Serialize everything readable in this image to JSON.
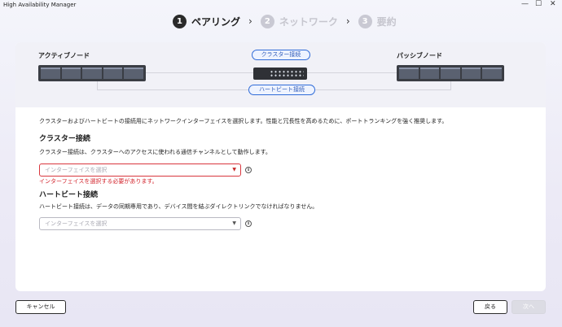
{
  "window": {
    "title": "High Availability Manager",
    "minimize_glyph": "—",
    "maximize_glyph": "☐",
    "close_glyph": "✕"
  },
  "stepper": {
    "steps": [
      {
        "number": "1",
        "label": "ペアリング",
        "active": true
      },
      {
        "number": "2",
        "label": "ネットワーク",
        "active": false
      },
      {
        "number": "3",
        "label": "要約",
        "active": false
      }
    ],
    "separator_glyph": "›"
  },
  "diagram": {
    "active_node_label": "アクティブノード",
    "passive_node_label": "パッシブノード",
    "cluster_link_label": "クラスター接続",
    "heartbeat_link_label": "ハートビート接続"
  },
  "description": "クラスターおよびハートビートの接続用にネットワークインターフェイスを選択します。性能と冗長性を高めるために、ポートトランキングを強く推奨します。",
  "cluster": {
    "title": "クラスター接続",
    "description": "クラスター接続は、クラスターへのアクセスに使われる通信チャンネルとして動作します。",
    "select_placeholder": "インターフェイスを選択",
    "error": "インターフェイスを選択する必要があります。",
    "caret_glyph": "▼",
    "info_glyph": "i"
  },
  "heartbeat": {
    "title": "ハートビート接続",
    "description": "ハートビート接続は、データの同期専用であり、デバイス間を結ぶダイレクトリンクでなければなりません。",
    "select_placeholder": "インターフェイスを選択",
    "caret_glyph": "▼",
    "info_glyph": "i"
  },
  "footer": {
    "cancel_label": "キャンセル",
    "back_label": "戻る",
    "next_label": "次へ"
  },
  "colors": {
    "accent": "#2f6bd8",
    "error": "#d3262e",
    "active_step": "#2a2a2a",
    "inactive_step": "#c9c9d3"
  },
  "icons": {
    "info": "info-icon",
    "dropdown": "chevron-down-icon",
    "server": "server-icon",
    "switch": "network-switch-icon"
  }
}
